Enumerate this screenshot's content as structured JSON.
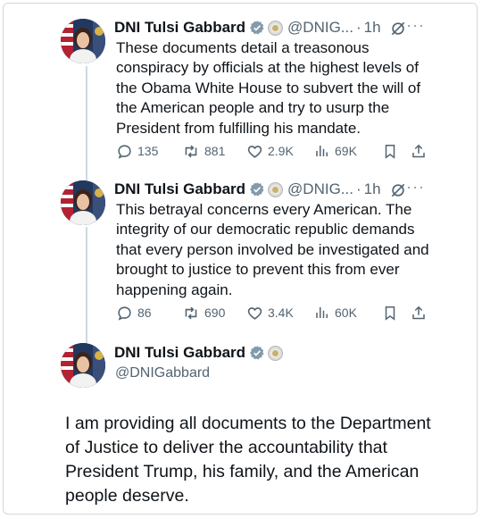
{
  "tweets": [
    {
      "name": "DNI Tulsi Gabbard",
      "handle": "@DNIG...",
      "time": "1h",
      "text": "These documents detail a treasonous conspiracy by officials at the highest levels of the Obama White House to subvert the will of the American people and try to usurp the President from fulfilling his mandate.",
      "replies": "135",
      "reposts": "881",
      "likes": "2.9K",
      "views": "69K"
    },
    {
      "name": "DNI Tulsi Gabbard",
      "handle": "@DNIG...",
      "time": "1h",
      "text": "This betrayal concerns every American. The integrity of our democratic republic demands that every person involved be investigated and brought to justice to prevent this from ever happening again.",
      "replies": "86",
      "reposts": "690",
      "likes": "3.4K",
      "views": "60K"
    }
  ],
  "main_tweet": {
    "name": "DNI Tulsi Gabbard",
    "handle": "@DNIGabbard",
    "text": "I am providing all documents to the Department of Justice to deliver the accountability that President Trump, his family, and the American people deserve."
  },
  "colors": {
    "verified": "#829aab",
    "muted": "#536471",
    "border": "#cfd9de"
  },
  "icons": [
    "reply-icon",
    "repost-icon",
    "like-icon",
    "views-icon",
    "bookmark-icon",
    "share-icon",
    "grok-icon",
    "more-icon",
    "verified-icon",
    "government-badge-icon"
  ]
}
